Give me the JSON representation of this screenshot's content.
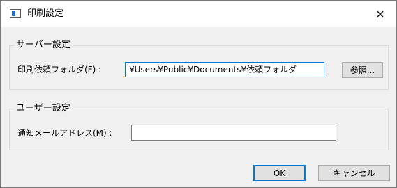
{
  "window": {
    "title": "印刷設定",
    "close_glyph": "✕"
  },
  "server_group": {
    "legend": "サーバー設定",
    "folder_label": "印刷依頼フォルダ(F) :",
    "folder_value": "¥Users¥Public¥Documents¥依頼フォルダ",
    "browse_label": "参照..."
  },
  "user_group": {
    "legend": "ユーザー設定",
    "mail_label": "通知メールアドレス(M) :",
    "mail_value": ""
  },
  "buttons": {
    "ok_label": "OK",
    "cancel_label": "キャンセル"
  },
  "colors": {
    "accent": "#0078d7",
    "dialog_bg": "#f0f0f0",
    "titlebar_bg": "#ffffff"
  }
}
